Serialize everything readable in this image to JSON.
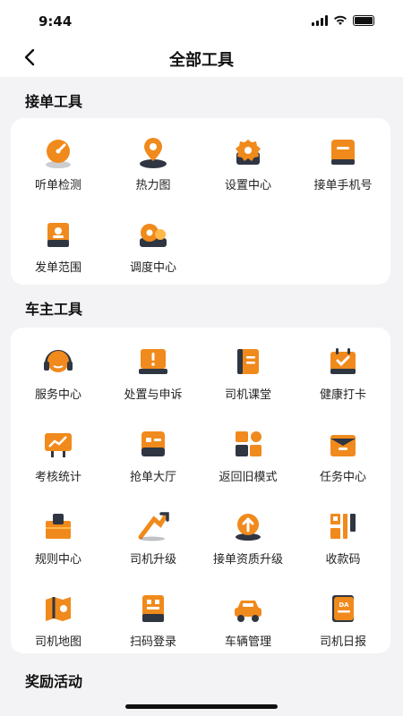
{
  "status": {
    "time": "9:44"
  },
  "nav": {
    "title": "全部工具"
  },
  "sections": {
    "order": {
      "title": "接单工具",
      "items": [
        {
          "label": "听单检测",
          "icon": "gauge-icon"
        },
        {
          "label": "热力图",
          "icon": "map-pin-icon"
        },
        {
          "label": "设置中心",
          "icon": "settings-icon"
        },
        {
          "label": "接单手机号",
          "icon": "phone-icon"
        },
        {
          "label": "发单范围",
          "icon": "range-icon"
        },
        {
          "label": "调度中心",
          "icon": "dispatch-icon"
        }
      ]
    },
    "owner": {
      "title": "车主工具",
      "items": [
        {
          "label": "服务中心",
          "icon": "headset-icon"
        },
        {
          "label": "处置与申诉",
          "icon": "alert-monitor-icon"
        },
        {
          "label": "司机课堂",
          "icon": "book-icon"
        },
        {
          "label": "健康打卡",
          "icon": "calendar-check-icon"
        },
        {
          "label": "考核统计",
          "icon": "chart-board-icon"
        },
        {
          "label": "抢单大厅",
          "icon": "hall-icon"
        },
        {
          "label": "返回旧模式",
          "icon": "shapes-icon"
        },
        {
          "label": "任务中心",
          "icon": "task-icon"
        },
        {
          "label": "规则中心",
          "icon": "rule-box-icon"
        },
        {
          "label": "司机升级",
          "icon": "upgrade-arrow-icon"
        },
        {
          "label": "接单资质升级",
          "icon": "badge-up-icon"
        },
        {
          "label": "收款码",
          "icon": "qr-code-icon"
        },
        {
          "label": "司机地图",
          "icon": "map-icon"
        },
        {
          "label": "扫码登录",
          "icon": "scan-login-icon"
        },
        {
          "label": "车辆管理",
          "icon": "car-icon"
        },
        {
          "label": "司机日报",
          "icon": "daily-report-icon"
        }
      ]
    },
    "rewards": {
      "title": "奖励活动"
    }
  },
  "colors": {
    "accent": "#f08a1c",
    "accent_light": "#ffb84a",
    "shadow": "#2f3642"
  }
}
